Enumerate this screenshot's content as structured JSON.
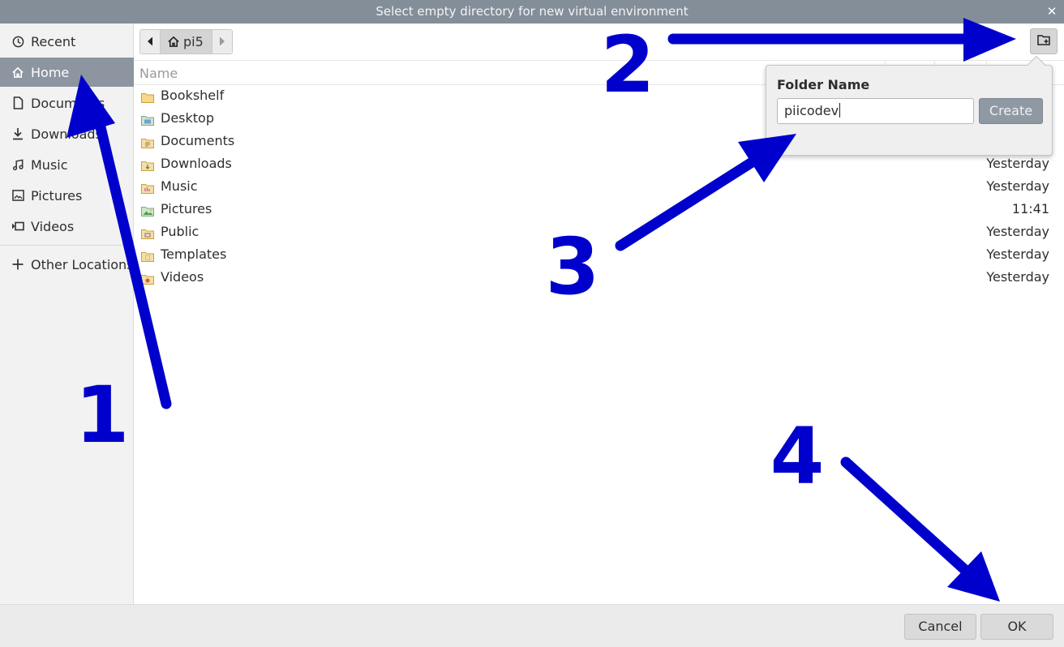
{
  "window": {
    "title": "Select empty directory for new virtual environment",
    "close_glyph": "✕"
  },
  "sidebar": {
    "items": [
      {
        "label": "Recent",
        "icon": "clock-icon"
      },
      {
        "label": "Home",
        "icon": "home-icon",
        "active": true
      },
      {
        "label": "Documents",
        "icon": "document-icon"
      },
      {
        "label": "Downloads",
        "icon": "download-icon"
      },
      {
        "label": "Music",
        "icon": "music-icon"
      },
      {
        "label": "Pictures",
        "icon": "picture-icon"
      },
      {
        "label": "Videos",
        "icon": "video-icon"
      }
    ],
    "other_locations": {
      "label": "Other Locations",
      "icon": "plus-icon"
    }
  },
  "pathbar": {
    "current": "pi5"
  },
  "list": {
    "header": {
      "name": "Name"
    },
    "rows": [
      {
        "name": "Bookshelf",
        "date": ""
      },
      {
        "name": "Desktop",
        "date": ""
      },
      {
        "name": "Documents",
        "date": ""
      },
      {
        "name": "Downloads",
        "date": "Yesterday"
      },
      {
        "name": "Music",
        "date": "Yesterday"
      },
      {
        "name": "Pictures",
        "date": "11:41"
      },
      {
        "name": "Public",
        "date": "Yesterday"
      },
      {
        "name": "Templates",
        "date": "Yesterday"
      },
      {
        "name": "Videos",
        "date": "Yesterday"
      }
    ]
  },
  "popover": {
    "label": "Folder Name",
    "input_value": "piicodev",
    "create_label": "Create"
  },
  "footer": {
    "cancel_label": "Cancel",
    "ok_label": "OK"
  },
  "annotations": {
    "step1": "1",
    "step2": "2",
    "step3": "3",
    "step4": "4",
    "color": "#0000cc"
  },
  "colors": {
    "titlebar": "#848e99",
    "selected": "#8c95a0",
    "create_button": "#8f99a4"
  }
}
